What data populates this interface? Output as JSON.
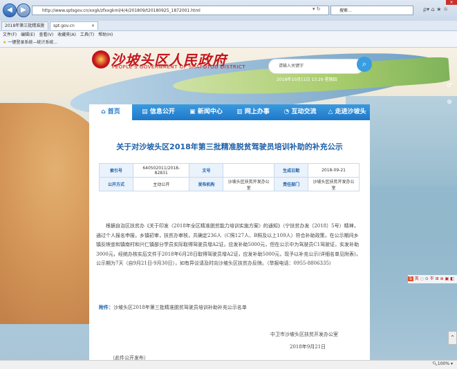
{
  "browser": {
    "address_url": "http://www.sptsgov.cn/xxgk/zfxxgkml/4/4/201809/t20180925_1872001.html",
    "search_placeholder": "搜索...",
    "tabs": [
      {
        "label": "2018年第三批精准脱贫..."
      },
      {
        "label": "spt.gov.cn"
      }
    ],
    "menu": {
      "file": "文件(F)",
      "edit": "编辑(E)",
      "view": "查看(V)",
      "favorites": "收藏夹(A)",
      "tools": "工具(T)",
      "help": "帮助(H)"
    },
    "favorites_bar": "一键登录系统—统计系统...",
    "zoom": "100%"
  },
  "site": {
    "title": "沙坡头区人民政府",
    "subtitle": "PEOPLE'S GOVERNMENT OF SHAPOTOU DISTRICT",
    "search_placeholder": "请输入关键字",
    "date": "2018年10月11日 13:29 星期四"
  },
  "nav": [
    {
      "label": "首页",
      "icon": "home-icon",
      "active": true
    },
    {
      "label": "信息公开",
      "icon": "document-icon"
    },
    {
      "label": "新闻中心",
      "icon": "news-icon"
    },
    {
      "label": "网上办事",
      "icon": "service-icon"
    },
    {
      "label": "互动交流",
      "icon": "chat-icon"
    },
    {
      "label": "走进沙坡头",
      "icon": "location-icon"
    }
  ],
  "article": {
    "title": "关于对沙坡头区2018年第三批精准脱贫驾驶员培训补助的补充公示",
    "meta": [
      {
        "k1": "索引号",
        "v1": "640502011/2018-82831",
        "k2": "文号",
        "v2": "",
        "k3": "生成日期",
        "v3": "2018-09-21"
      },
      {
        "k1": "公开方式",
        "v1": "主动公开",
        "k2": "发布机构",
        "v2": "沙坡头区扶贫开发办公室",
        "k3": "责任部门",
        "v3": "沙坡头区扶贫开发办公室"
      }
    ],
    "body": "根据自治区扶贫办《关于印发〈2018年全区精准脱贫能力培训实施方案〉的通知》（宁扶贫办发〔2018〕5号）精神，通过个人报名申报，乡镇初审，扶贫办审核，共确定236人（C照127人、B照及以上109人）符合补助政策，在公示期间乡镇反映宣和镇南村和兴仁镇部分学员实际取得驾驶员增A2证，应发补助5000元，但在公示中为驾驶员C1驾驶证，实发补助3000元，经统办核实后文件于2018年6月28日取得驾驶员增A2证，应发补助5000元，现予以补充公示(详细名单见附表)，公示期为7天（自9月21日-9月30日），如有异议请及时向沙坡头区扶贫办反映。（举报电话：0955-8806335）",
    "attachment_label": "附件：",
    "attachment_text": "沙坡头区2018年第三批精准脱贫驾驶员培训补助补充公示名单",
    "sign_org": "中卫市沙坡头区扶贫开发办公室",
    "sign_date": "2018年9月21日",
    "public_note": "（此件公开发布）"
  },
  "side": {
    "float_text": "英 ◌ ⊙ 半 ⊞ ⊕ ▣ ◧"
  }
}
